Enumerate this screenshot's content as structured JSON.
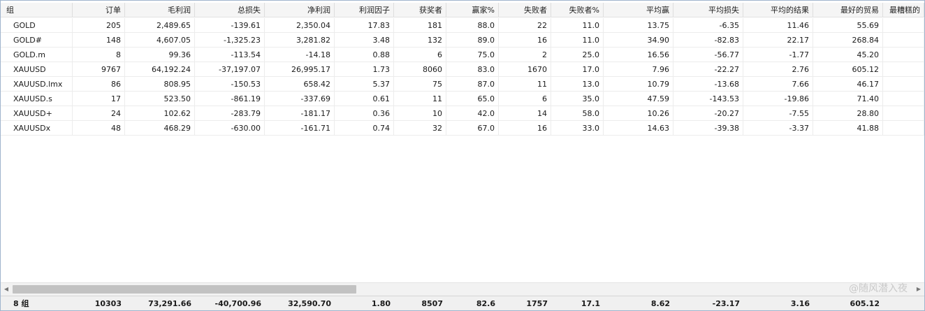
{
  "columns": [
    "组",
    "订单",
    "毛利润",
    "总损失",
    "净利润",
    "利润因子",
    "获奖者",
    "赢家%",
    "失败者",
    "失败者%",
    "平均赢",
    "平均损失",
    "平均的结果",
    "最好的贸易",
    "最糟糕的"
  ],
  "rows": [
    [
      "GOLD",
      "205",
      "2,489.65",
      "-139.61",
      "2,350.04",
      "17.83",
      "181",
      "88.0",
      "22",
      "11.0",
      "13.75",
      "-6.35",
      "11.46",
      "55.69",
      ""
    ],
    [
      "GOLD#",
      "148",
      "4,607.05",
      "-1,325.23",
      "3,281.82",
      "3.48",
      "132",
      "89.0",
      "16",
      "11.0",
      "34.90",
      "-82.83",
      "22.17",
      "268.84",
      ""
    ],
    [
      "GOLD.m",
      "8",
      "99.36",
      "-113.54",
      "-14.18",
      "0.88",
      "6",
      "75.0",
      "2",
      "25.0",
      "16.56",
      "-56.77",
      "-1.77",
      "45.20",
      ""
    ],
    [
      "XAUUSD",
      "9767",
      "64,192.24",
      "-37,197.07",
      "26,995.17",
      "1.73",
      "8060",
      "83.0",
      "1670",
      "17.0",
      "7.96",
      "-22.27",
      "2.76",
      "605.12",
      ""
    ],
    [
      "XAUUSD.lmx",
      "86",
      "808.95",
      "-150.53",
      "658.42",
      "5.37",
      "75",
      "87.0",
      "11",
      "13.0",
      "10.79",
      "-13.68",
      "7.66",
      "46.17",
      ""
    ],
    [
      "XAUUSD.s",
      "17",
      "523.50",
      "-861.19",
      "-337.69",
      "0.61",
      "11",
      "65.0",
      "6",
      "35.0",
      "47.59",
      "-143.53",
      "-19.86",
      "71.40",
      ""
    ],
    [
      "XAUUSD+",
      "24",
      "102.62",
      "-283.79",
      "-181.17",
      "0.36",
      "10",
      "42.0",
      "14",
      "58.0",
      "10.26",
      "-20.27",
      "-7.55",
      "28.80",
      ""
    ],
    [
      "XAUUSDx",
      "48",
      "468.29",
      "-630.00",
      "-161.71",
      "0.74",
      "32",
      "67.0",
      "16",
      "33.0",
      "14.63",
      "-39.38",
      "-3.37",
      "41.88",
      ""
    ]
  ],
  "footer": [
    "8 组",
    "10303",
    "73,291.66",
    "-40,700.96",
    "32,590.70",
    "1.80",
    "8507",
    "82.6",
    "1757",
    "17.1",
    "8.62",
    "-23.17",
    "3.16",
    "605.12",
    ""
  ],
  "scrollbar": {
    "left_arrow": "◀",
    "right_arrow": "▶"
  },
  "watermark": "@随风潜入夜",
  "colors": {
    "border": "#9fb4cd",
    "header_bg": "#f5f5f5",
    "footer_bg": "#f0f0f0",
    "scroll_thumb": "#c2c2c2"
  }
}
